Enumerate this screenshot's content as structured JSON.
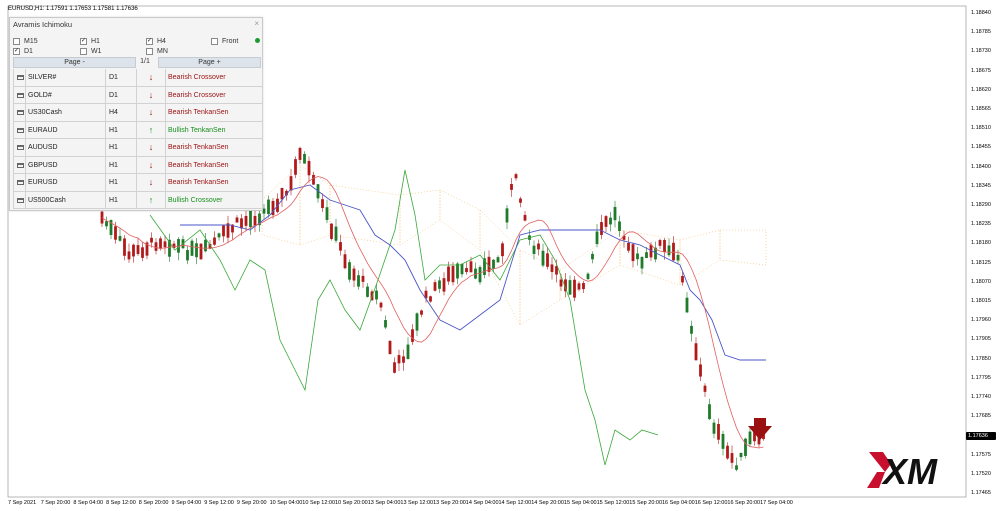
{
  "chart": {
    "symbol_line": "EURUSD,H1: 1.17591 1.17653 1.17581 1.17636",
    "current_price": "1.17636",
    "price_ticks": [
      "1.18840",
      "1.18785",
      "1.18730",
      "1.18675",
      "1.18620",
      "1.18565",
      "1.18510",
      "1.18455",
      "1.18400",
      "1.18345",
      "1.18290",
      "1.18235",
      "1.18180",
      "1.18125",
      "1.18070",
      "1.18015",
      "1.17960",
      "1.17905",
      "1.17850",
      "1.17795",
      "1.17740",
      "1.17685",
      "1.17630",
      "1.17575",
      "1.17520",
      "1.17465"
    ],
    "time_ticks": [
      "7 Sep 2021",
      "7 Sep 20:00",
      "8 Sep 04:00",
      "8 Sep 12:00",
      "8 Sep 20:00",
      "9 Sep 04:00",
      "9 Sep 12:00",
      "9 Sep 20:00",
      "10 Sep 04:00",
      "10 Sep 12:00",
      "10 Sep 20:00",
      "13 Sep 04:00",
      "13 Sep 12:00",
      "13 Sep 20:00",
      "14 Sep 04:00",
      "14 Sep 12:00",
      "14 Sep 20:00",
      "15 Sep 04:00",
      "15 Sep 12:00",
      "15 Sep 20:00",
      "16 Sep 04:00",
      "16 Sep 12:00",
      "16 Sep 20:00",
      "17 Sep 04:00"
    ],
    "colors": {
      "bull_candle": "#1f7a2a",
      "bear_candle": "#b01a1a",
      "tenkan": "#e06060",
      "kijun": "#4a56c8",
      "chikou": "#3aa83a",
      "cloud": "#f0a030"
    }
  },
  "panel": {
    "title": "Avramis Ichimoku",
    "timeframes": [
      {
        "label": "M15",
        "checked": false
      },
      {
        "label": "H1",
        "checked": true
      },
      {
        "label": "H4",
        "checked": true
      },
      {
        "label": "Front",
        "checked": false
      },
      {
        "label": "D1",
        "checked": true
      },
      {
        "label": "W1",
        "checked": false
      },
      {
        "label": "MN",
        "checked": false
      }
    ],
    "page_prev": "Page -",
    "page_num": "1/1",
    "page_next": "Page +",
    "rows": [
      {
        "symbol": "SILVER#",
        "tf": "D1",
        "dir": "down",
        "signal": "Bearish Crossover"
      },
      {
        "symbol": "GOLD#",
        "tf": "D1",
        "dir": "down",
        "signal": "Bearish Crossover"
      },
      {
        "symbol": "US30Cash",
        "tf": "H4",
        "dir": "down",
        "signal": "Bearish TenkanSen"
      },
      {
        "symbol": "EURAUD",
        "tf": "H1",
        "dir": "up",
        "signal": "Bullish TenkanSen"
      },
      {
        "symbol": "AUDUSD",
        "tf": "H1",
        "dir": "down",
        "signal": "Bearish TenkanSen"
      },
      {
        "symbol": "GBPUSD",
        "tf": "H1",
        "dir": "down",
        "signal": "Bearish TenkanSen"
      },
      {
        "symbol": "EURUSD",
        "tf": "H1",
        "dir": "down",
        "signal": "Bearish TenkanSen"
      },
      {
        "symbol": "US500Cash",
        "tf": "H1",
        "dir": "up",
        "signal": "Bullish Crossover"
      }
    ]
  },
  "logo": {
    "text": "XM"
  }
}
